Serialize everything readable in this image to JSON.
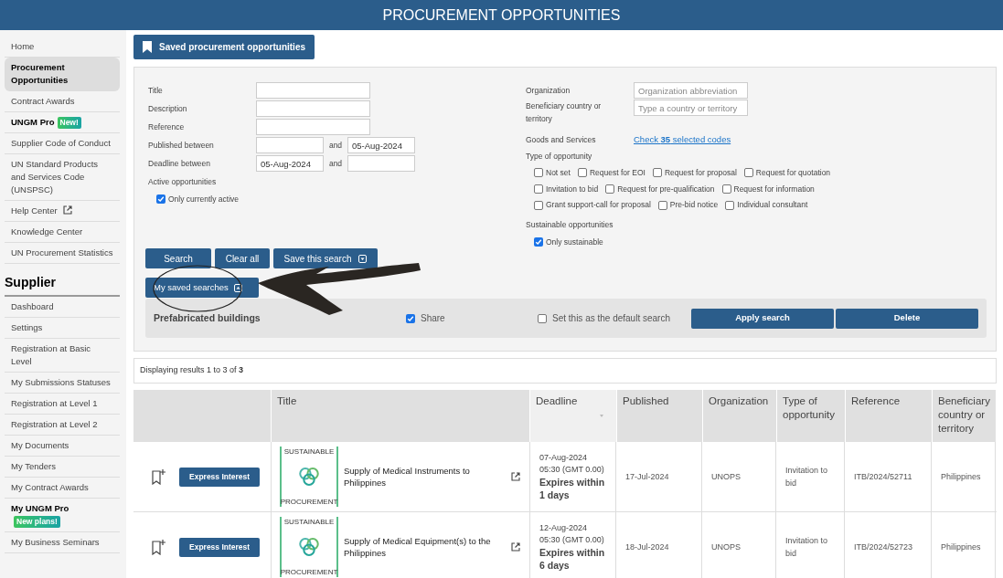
{
  "header": {
    "title": "PROCUREMENT OPPORTUNITIES"
  },
  "sidebar": {
    "items": [
      {
        "label": "Home",
        "selected": false
      },
      {
        "label": "Procurement Opportunities",
        "selected": true
      },
      {
        "label": "Contract Awards",
        "selected": false
      },
      {
        "label": "UNGM Pro",
        "selected": false,
        "bold": true,
        "badge": "New!"
      },
      {
        "label": "Supplier Code of Conduct",
        "selected": false
      },
      {
        "label": "UN Standard Products and Services Code (UNSPSC)",
        "selected": false
      },
      {
        "label": "Help Center",
        "selected": false,
        "external": true
      },
      {
        "label": "Knowledge Center",
        "selected": false
      },
      {
        "label": "UN Procurement Statistics",
        "selected": false
      }
    ],
    "section": "Supplier",
    "section_items": [
      {
        "label": "Dashboard",
        "selected": false
      },
      {
        "label": "Settings",
        "selected": false
      },
      {
        "label": "Registration at Basic Level",
        "selected": false
      },
      {
        "label": "My Submissions Statuses",
        "selected": false
      },
      {
        "label": "Registration at Level 1",
        "selected": false
      },
      {
        "label": "Registration at Level 2",
        "selected": false
      },
      {
        "label": "My Documents",
        "selected": false
      },
      {
        "label": "My Tenders",
        "selected": false
      },
      {
        "label": "My Contract Awards",
        "selected": false
      },
      {
        "label": "My UNGM Pro",
        "selected": false,
        "bold": true,
        "badge": "New plans!"
      },
      {
        "label": "My Business Seminars",
        "selected": false
      }
    ]
  },
  "saved_button": "Saved procurement opportunities",
  "form": {
    "left_fields": [
      {
        "label": "Title",
        "kind": "single"
      },
      {
        "label": "Description",
        "kind": "single"
      },
      {
        "label": "Reference",
        "kind": "single"
      },
      {
        "label": "Published between",
        "kind": "range",
        "joiner": "and",
        "to": "05-Aug-2024"
      },
      {
        "label": "Deadline between",
        "kind": "range",
        "joiner": "and",
        "from": "05-Aug-2024"
      }
    ],
    "active": {
      "label": "Active opportunities",
      "option": "Only currently active",
      "checked": true
    },
    "organization": {
      "label": "Organization",
      "placeholder": "Organization abbreviation"
    },
    "country": {
      "label": "Beneficiary country or territory",
      "placeholder": "Type a country or territory"
    },
    "goods": {
      "label": "Goods and Services",
      "link": "Check **35** selected codes"
    },
    "types": {
      "label": "Type of opportunity",
      "options": [
        {
          "label": "Not set",
          "checked": false
        },
        {
          "label": "Request for EOI",
          "checked": false
        },
        {
          "label": "Request for proposal",
          "checked": false
        },
        {
          "label": "Request for quotation",
          "checked": false
        },
        {
          "label": "Invitation to bid",
          "checked": false
        },
        {
          "label": "Request for pre-qualification",
          "checked": false
        },
        {
          "label": "Request for information",
          "checked": false
        },
        {
          "label": "Grant support-call for proposal",
          "checked": false
        },
        {
          "label": "Pre-bid notice",
          "checked": false
        },
        {
          "label": "Individual consultant",
          "checked": false
        }
      ]
    },
    "sustainable": {
      "label": "Sustainable opportunities",
      "option": "Only sustainable",
      "checked": true
    },
    "buttons": [
      "Search",
      "Clear all",
      "Save this search"
    ],
    "my_saved": {
      "label": "My saved searches",
      "expanded": true
    },
    "saved_search": {
      "name": "Prefabricated buildings",
      "share": "Share",
      "share_checked": true,
      "default": "Set this as the default search",
      "default_checked": false,
      "apply": "Apply search",
      "delete": "Delete"
    }
  },
  "results": "Displaying results 1 to 3 of **3**",
  "table": {
    "columns": [
      {
        "label": "Title",
        "sorted": false
      },
      {
        "label": "Deadline",
        "sorted": true
      },
      {
        "label": "Published",
        "sorted": false
      },
      {
        "label": "Organization",
        "sorted": false
      },
      {
        "label": "Type of opportunity",
        "sorted": false
      },
      {
        "label": "Reference",
        "sorted": false
      },
      {
        "label": "Beneficiary country or territory",
        "sorted": false
      }
    ],
    "rows": [
      {
        "action": "Express Interest",
        "logo_top": "SUSTAINABLE",
        "logo_bottom": "PROCUREMENT",
        "title": "Supply of Medical Instruments to Philippines",
        "deadline": "07-Aug-2024",
        "time": "05:30 (GMT 0.00)",
        "expires": "Expires within 1 days",
        "published": "17-Jul-2024",
        "organization": "UNOPS",
        "type": "Invitation to bid",
        "reference": "ITB/2024/52711",
        "country": "Philippines"
      },
      {
        "action": "Express Interest",
        "logo_top": "SUSTAINABLE",
        "logo_bottom": "PROCUREMENT",
        "title": "Supply of Medical Equipment(s) to the Philippines",
        "deadline": "12-Aug-2024",
        "time": "05:30 (GMT 0.00)",
        "expires": "Expires within 6 days",
        "published": "18-Jul-2024",
        "organization": "UNOPS",
        "type": "Invitation to bid",
        "reference": "ITB/2024/52723",
        "country": "Philippines"
      }
    ]
  }
}
